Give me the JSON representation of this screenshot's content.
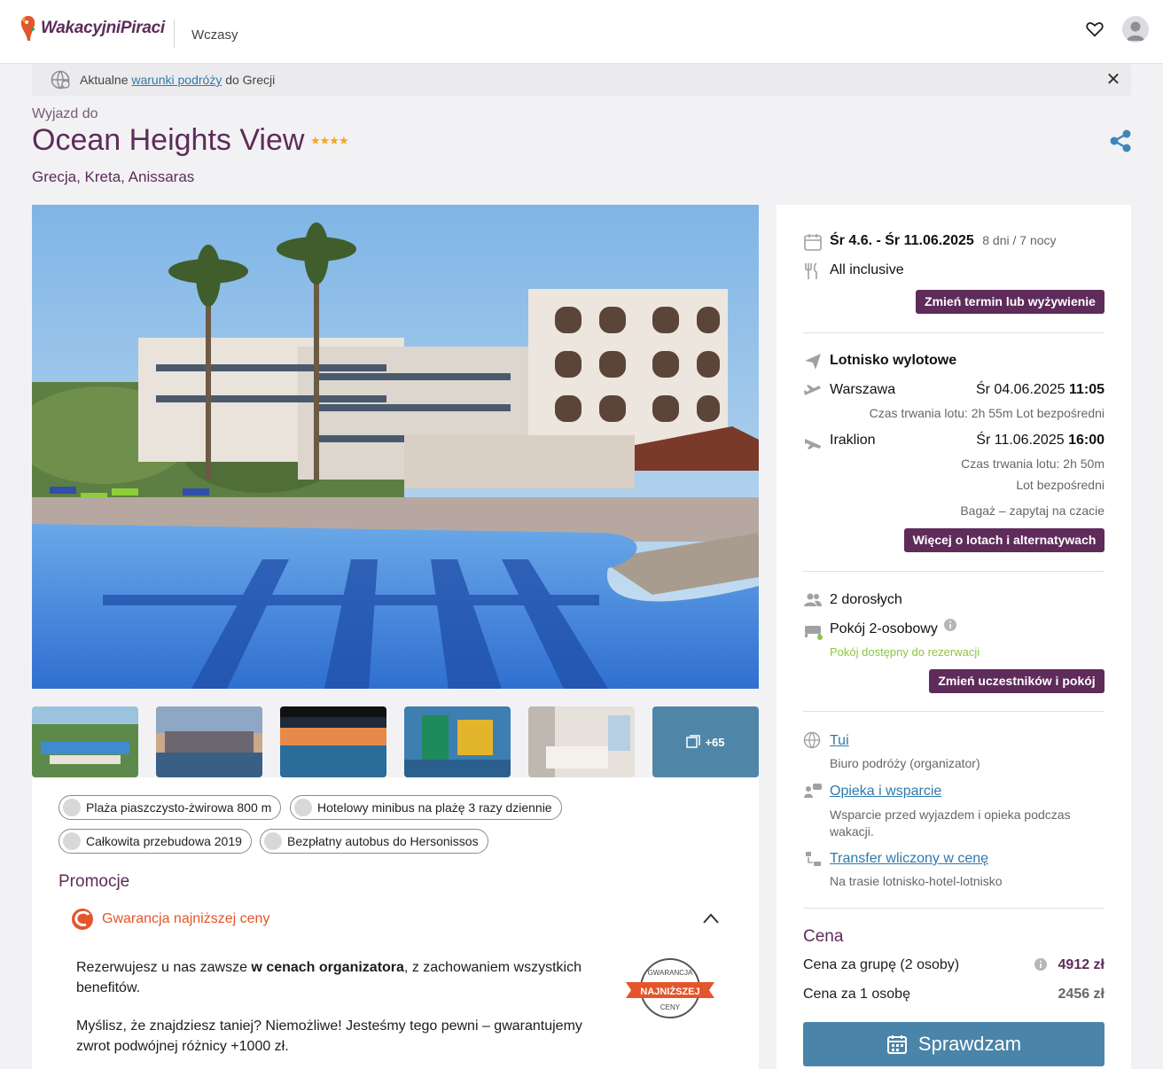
{
  "header": {
    "logo_text": "WakacyjniPiraci",
    "nav_item": "Wczasy"
  },
  "alert": {
    "prefix": "Aktualne",
    "link": "warunki podróży",
    "suffix": "do Grecji"
  },
  "hotel": {
    "pretitle": "Wyjazd do",
    "name": "Ocean Heights View",
    "stars": "★★★★",
    "location": "Grecja, Kreta, Anissaras"
  },
  "gallery": {
    "more_count": "+65"
  },
  "tags": [
    "Plaża piaszczysto-żwirowa 800 m",
    "Hotelowy minibus na plażę 3 razy dziennie",
    "Całkowita przebudowa 2019",
    "Bezpłatny autobus do Hersonissos"
  ],
  "promo": {
    "heading": "Promocje",
    "guarantee_title": "Gwarancja najniższej ceny",
    "p1_a": "Rezerwujesz u nas zawsze ",
    "p1_b": "w cenach organizatora",
    "p1_c": ", z zachowaniem wszystkich benefitów.",
    "p2": "Myślisz, że znajdziesz taniej? Niemożliwe! Jesteśmy tego pewni – gwarantujemy zwrot podwójnej różnicy +1000 zł.",
    "seal_top": "GWARANCJA",
    "seal_mid": "NAJNIŻSZEJ",
    "seal_bottom": "CENY"
  },
  "booking": {
    "dates": "Śr 4.6. - Śr 11.06.2025",
    "duration": "8 dni / 7 nocy",
    "board": "All inclusive",
    "change_term_btn": "Zmień termin lub wyżywienie",
    "airport_label": "Lotnisko wylotowe",
    "out_city": "Warszawa",
    "out_date": "Śr 04.06.2025",
    "out_time": "11:05",
    "out_info": "Czas trwania lotu: 2h 55m  Lot bezpośredni",
    "ret_city": "Iraklion",
    "ret_date": "Śr 11.06.2025",
    "ret_time": "16:00",
    "ret_duration": "Czas trwania lotu: 2h 50m",
    "ret_direct": "Lot bezpośredni",
    "baggage": "Bagaż – zapytaj na czacie",
    "flights_btn": "Więcej o lotach i alternatywach",
    "adults": "2 dorosłych",
    "room": "Pokój 2-osobowy",
    "room_status": "Pokój dostępny do rezerwacji",
    "change_people_btn": "Zmień uczestników i pokój",
    "operator_link": "Tui",
    "operator_desc": "Biuro podróży (organizator)",
    "support_link": "Opieka i wsparcie",
    "support_desc": "Wsparcie przed wyjazdem i opieka podczas wakacji.",
    "transfer_link": "Transfer wliczony w cenę",
    "transfer_desc": "Na trasie lotnisko-hotel-lotnisko",
    "price_heading": "Cena",
    "group_label": "Cena za grupę (2 osoby)",
    "group_price": "4912 zł",
    "person_label": "Cena za 1 osobę",
    "person_price": "2456 zł",
    "cta": "Sprawdzam"
  },
  "colors": {
    "brand_purple": "#5e2b5a",
    "accent_blue": "#4a84a8",
    "link_blue": "#2f7aab",
    "promo_orange": "#e3552a",
    "available_green": "#8cc63f"
  }
}
